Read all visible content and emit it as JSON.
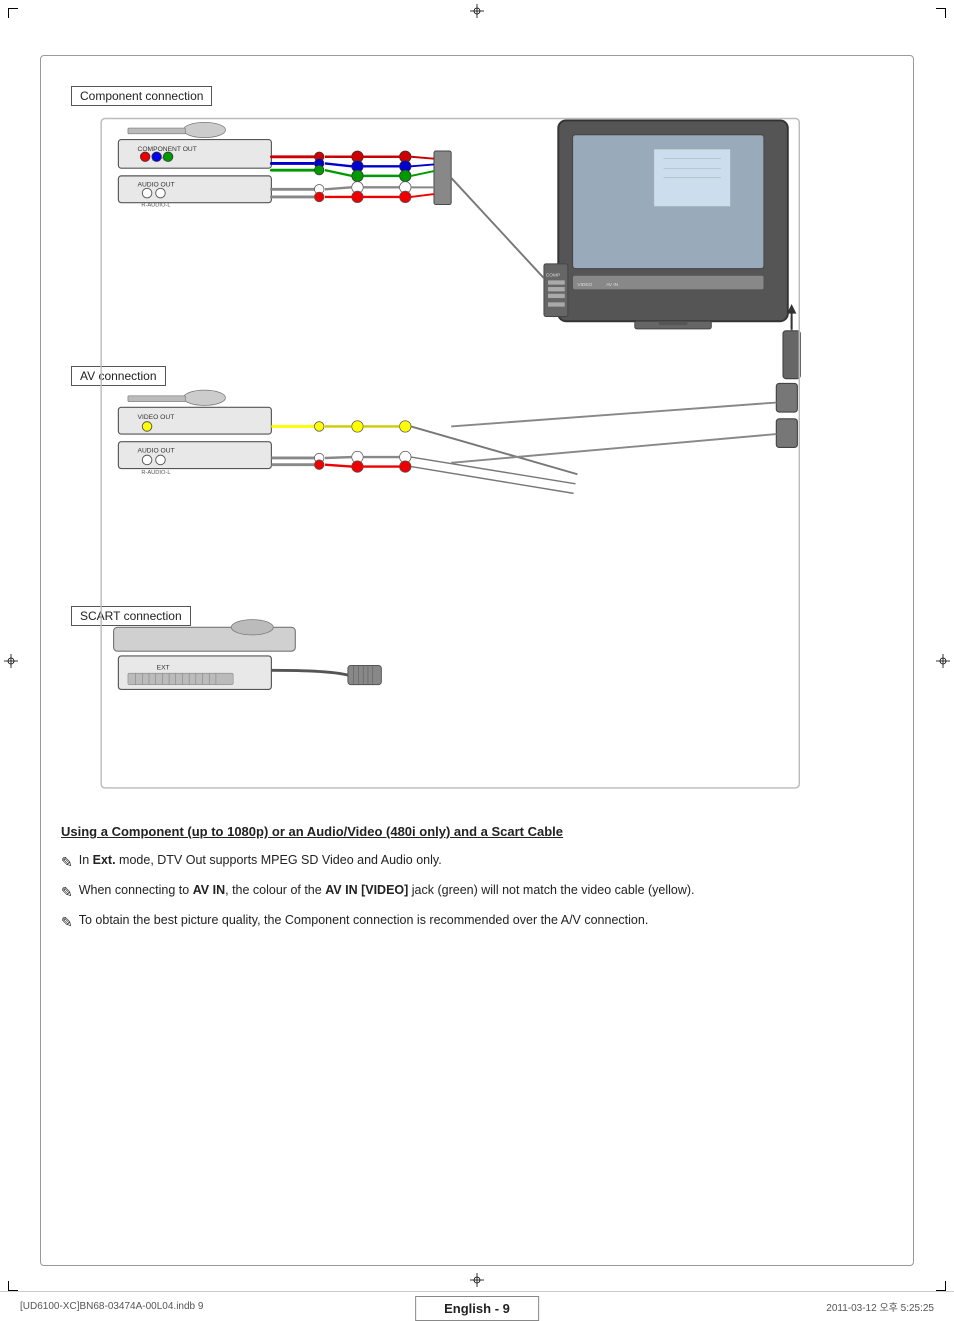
{
  "page": {
    "title": "English - 9",
    "footer_left": "[UD6100-XC]BN68-03474A-00L04.indb   9",
    "footer_right": "2011-03-12   오후 5:25:25"
  },
  "diagram": {
    "section1_label": "Component connection",
    "section2_label": "AV connection",
    "section3_label": "SCART connection",
    "labels": {
      "component_out": "COMPONENT OUT",
      "audio_out_1": "AUDIO OUT",
      "r_audio_l_1": "R-AUDIO-L",
      "video_out": "VIDEO OUT",
      "audio_out_2": "AUDIO OUT",
      "r_audio_l_2": "R-AUDIO-L",
      "ext": "EXT"
    }
  },
  "notes": {
    "title": "Using a Component (up to 1080p) or an Audio/Video (480i only) and a Scart Cable",
    "items": [
      {
        "text_parts": [
          {
            "text": "In ",
            "bold": false
          },
          {
            "text": "Ext.",
            "bold": true
          },
          {
            "text": " mode, DTV Out supports MPEG SD Video and Audio only.",
            "bold": false
          }
        ],
        "full_text": "In Ext. mode, DTV Out supports MPEG SD Video and Audio only."
      },
      {
        "full_text": "When connecting to AV IN, the colour of the AV IN [VIDEO] jack (green) will not match the video cable (yellow).",
        "bold_words": [
          "AV IN",
          "AV IN [VIDEO]"
        ]
      },
      {
        "full_text": "To obtain the best picture quality, the Component connection is recommended over the A/V connection.",
        "bold_words": []
      }
    ]
  }
}
